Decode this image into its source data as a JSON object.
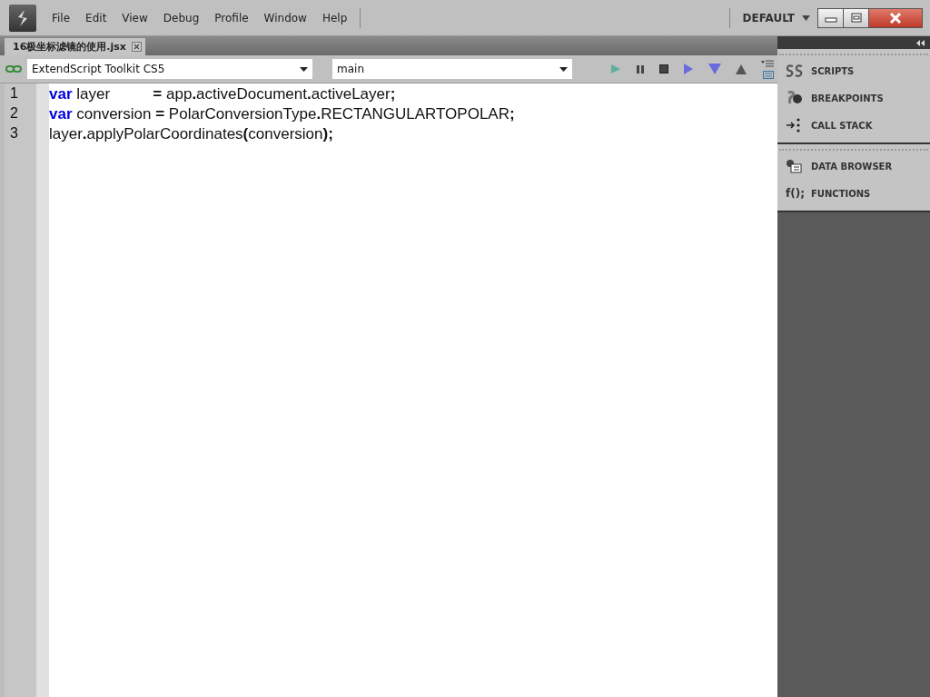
{
  "menu": [
    "File",
    "Edit",
    "View",
    "Debug",
    "Profile",
    "Window",
    "Help"
  ],
  "workspace": "DEFAULT",
  "tabs": [
    {
      "label": "16极坐标滤镜的使用.jsx",
      "selected": true
    }
  ],
  "target": {
    "value": "ExtendScript Toolkit CS5"
  },
  "engine": {
    "value": "main"
  },
  "code": [
    {
      "number": "1",
      "tokens": [
        {
          "kind": "keyword",
          "text": "var"
        },
        {
          "kind": "text",
          "text": " layer          "
        },
        {
          "kind": "punct",
          "text": "="
        },
        {
          "kind": "text",
          "text": " app"
        },
        {
          "kind": "punct",
          "text": "."
        },
        {
          "kind": "text",
          "text": "activeDocument"
        },
        {
          "kind": "punct",
          "text": "."
        },
        {
          "kind": "text",
          "text": "activeLayer"
        },
        {
          "kind": "punct",
          "text": ";"
        }
      ]
    },
    {
      "number": "2",
      "tokens": [
        {
          "kind": "keyword",
          "text": "var"
        },
        {
          "kind": "text",
          "text": " conversion "
        },
        {
          "kind": "punct",
          "text": "="
        },
        {
          "kind": "text",
          "text": " PolarConversionType"
        },
        {
          "kind": "punct",
          "text": "."
        },
        {
          "kind": "text",
          "text": "RECTANGULARTOPOLAR"
        },
        {
          "kind": "punct",
          "text": ";"
        }
      ]
    },
    {
      "number": "3",
      "tokens": [
        {
          "kind": "text",
          "text": "layer"
        },
        {
          "kind": "punct",
          "text": "."
        },
        {
          "kind": "text",
          "text": "applyPolarCoordinates"
        },
        {
          "kind": "punct",
          "text": "("
        },
        {
          "kind": "text",
          "text": "conversion"
        },
        {
          "kind": "punct",
          "text": ");"
        }
      ]
    }
  ],
  "panels": [
    {
      "items": [
        {
          "kind": "scripts",
          "label": "SCRIPTS"
        },
        {
          "kind": "breakpoints",
          "label": "BREAKPOINTS"
        },
        {
          "kind": "callstack",
          "label": "CALL STACK"
        }
      ]
    },
    {
      "items": [
        {
          "kind": "data",
          "label": "DATA BROWSER"
        },
        {
          "kind": "functions",
          "label": "FUNCTIONS",
          "glyph": "f();"
        }
      ]
    }
  ]
}
